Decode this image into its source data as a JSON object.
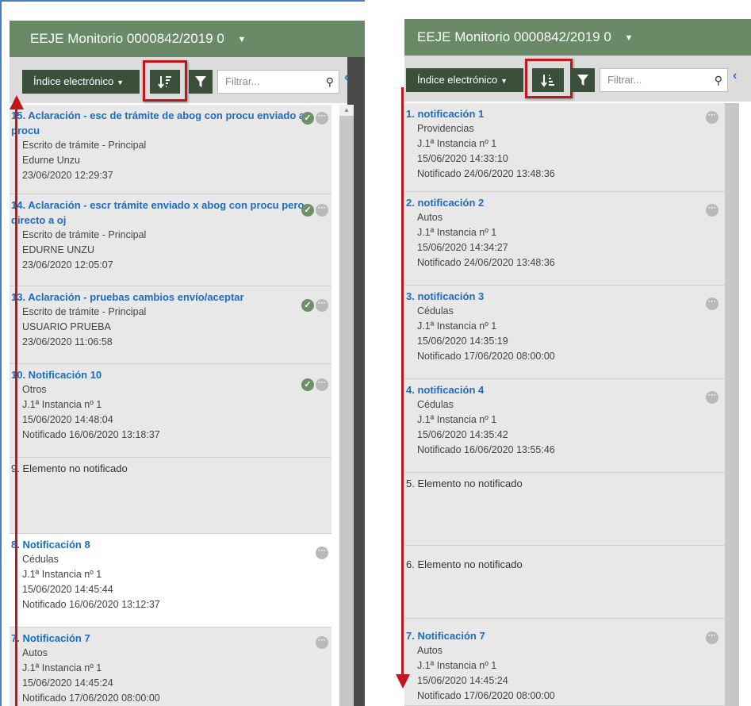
{
  "left": {
    "title": "EEJE Monitorio 0000842/2019 0",
    "index_button": "Índice electrónico",
    "filter_placeholder": "Filtrar...",
    "sort_order": "descending",
    "items": [
      {
        "title": "15. Aclaración - esc de trámite de abog con procu enviado a procu",
        "lines": [
          "Escrito de trámite - Principal",
          "Edurne Unzu",
          "23/06/2020 12:29:37"
        ],
        "checked": true
      },
      {
        "title": "14. Aclaración - escr trámite enviado x abog con procu pero directo a oj",
        "lines": [
          "Escrito de trámite - Principal",
          "EDURNE UNZU",
          "23/06/2020 12:05:07"
        ],
        "checked": true
      },
      {
        "title": "13. Aclaración - pruebas cambios envío/aceptar",
        "lines": [
          "Escrito de trámite - Principal",
          "USUARIO PRUEBA",
          "23/06/2020 11:06:58"
        ],
        "checked": true
      },
      {
        "title": "10. Notificación 10",
        "lines": [
          "Otros",
          "J.1ª Instancia nº 1",
          "15/06/2020 14:48:04",
          "Notificado 16/06/2020 13:18:37"
        ],
        "checked": true
      },
      {
        "title": "9. Elemento no notificado",
        "lines": [],
        "checked": false
      },
      {
        "title": "8. Notificación 8",
        "lines": [
          "Cédulas",
          "J.1ª Instancia nº 1",
          "15/06/2020 14:45:44",
          "Notificado 16/06/2020 13:12:37"
        ],
        "checked": false
      },
      {
        "title": "7. Notificación 7",
        "lines": [
          "Autos",
          "J.1ª Instancia nº 1",
          "15/06/2020 14:45:24",
          "Notificado 17/06/2020 08:00:00"
        ],
        "checked": false
      }
    ]
  },
  "right": {
    "title": "EEJE Monitorio 0000842/2019 0",
    "index_button": "Índice electrónico",
    "filter_placeholder": "Filtrar...",
    "sort_order": "ascending",
    "items": [
      {
        "title": "1. notificación 1",
        "lines": [
          "Providencias",
          "J.1ª Instancia nº 1",
          "15/06/2020 14:33:10",
          "Notificado 24/06/2020 13:48:36"
        ]
      },
      {
        "title": "2. notificación 2",
        "lines": [
          "Autos",
          "J.1ª Instancia nº 1",
          "15/06/2020 14:34:27",
          "Notificado 24/06/2020 13:48:36"
        ]
      },
      {
        "title": "3. notificación 3",
        "lines": [
          "Cédulas",
          "J.1ª Instancia nº 1",
          "15/06/2020 14:35:19",
          "Notificado 17/06/2020 08:00:00"
        ]
      },
      {
        "title": "4. notificación 4",
        "lines": [
          "Cédulas",
          "J.1ª Instancia nº 1",
          "15/06/2020 14:35:42",
          "Notificado 16/06/2020 13:55:46"
        ]
      },
      {
        "title": "5. Elemento no notificado",
        "lines": []
      },
      {
        "title": "6. Elemento no notificado",
        "lines": []
      },
      {
        "title": "7. Notificación 7",
        "lines": [
          "Autos",
          "J.1ª Instancia nº 1",
          "15/06/2020 14:45:24",
          "Notificado 17/06/2020 08:00:00"
        ]
      }
    ]
  },
  "colors": {
    "header": "#6a8a67",
    "button": "#3b503a",
    "link": "#1c6cc0",
    "highlight": "#c0161e"
  }
}
